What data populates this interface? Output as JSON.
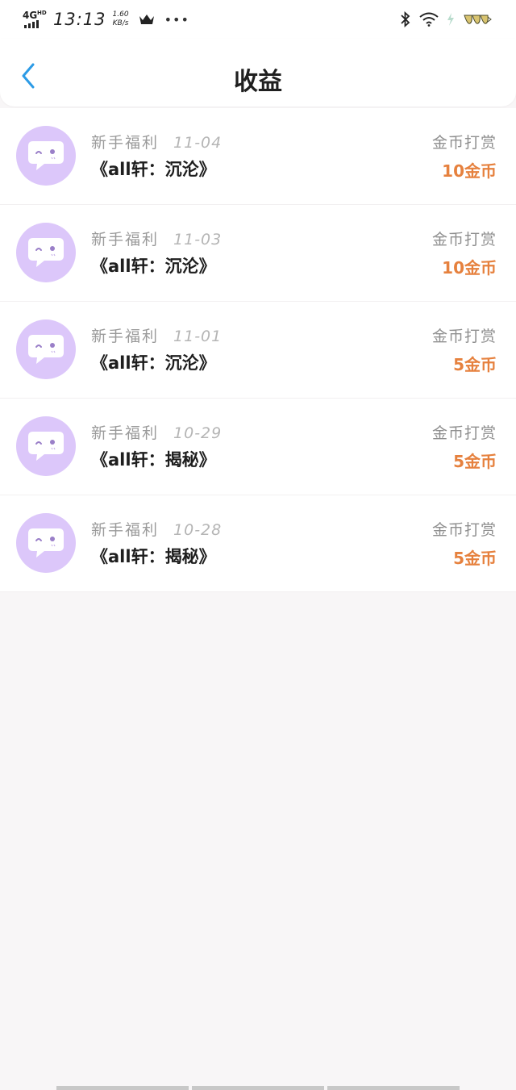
{
  "status_bar": {
    "network": "4G",
    "network_sub": "HD",
    "time": "13:13",
    "speed_value": "1.60",
    "speed_unit": "KB/s",
    "dots": "•••"
  },
  "header": {
    "title": "收益"
  },
  "colors": {
    "accent_back": "#2c9be6",
    "amount": "#e6813e",
    "avatar_bg": "#dcc7fa"
  },
  "income_items": [
    {
      "type": "新手福利",
      "date": "11-04",
      "title": "《all轩：沉沦》",
      "kind": "金币打赏",
      "amount": "10金币"
    },
    {
      "type": "新手福利",
      "date": "11-03",
      "title": "《all轩：沉沦》",
      "kind": "金币打赏",
      "amount": "10金币"
    },
    {
      "type": "新手福利",
      "date": "11-01",
      "title": "《all轩：沉沦》",
      "kind": "金币打赏",
      "amount": "5金币"
    },
    {
      "type": "新手福利",
      "date": "10-29",
      "title": "《all轩：揭秘》",
      "kind": "金币打赏",
      "amount": "5金币"
    },
    {
      "type": "新手福利",
      "date": "10-28",
      "title": "《all轩：揭秘》",
      "kind": "金币打赏",
      "amount": "5金币"
    }
  ]
}
